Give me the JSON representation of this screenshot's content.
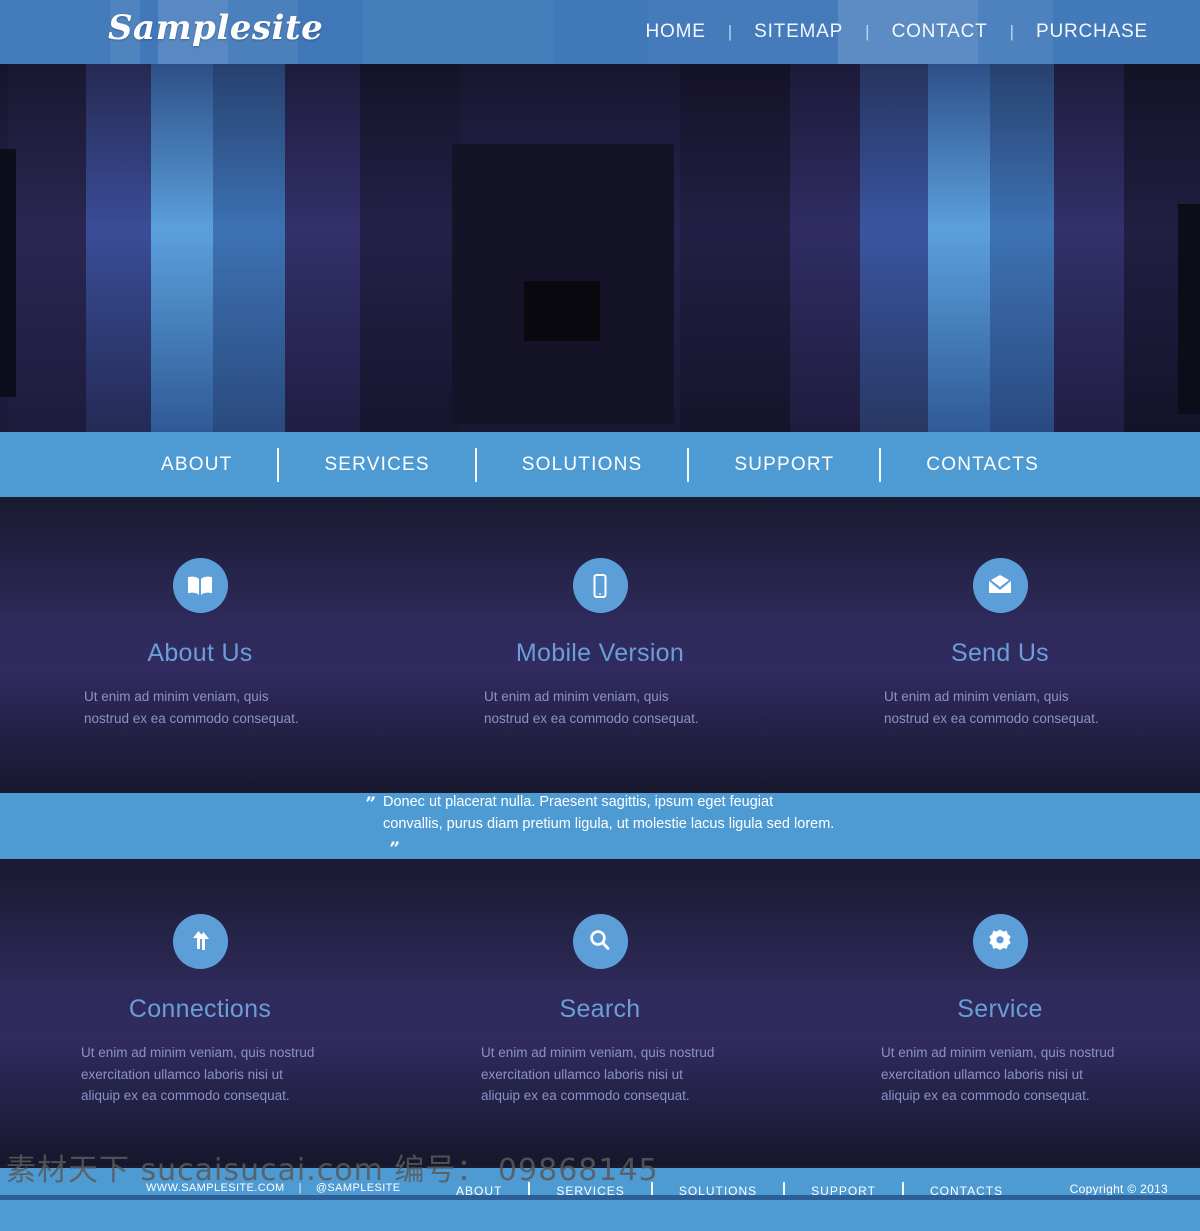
{
  "header": {
    "logo": "Samplesite",
    "nav": [
      {
        "label": "HOME"
      },
      {
        "label": "SITEMAP"
      },
      {
        "label": "CONTACT"
      },
      {
        "label": "PURCHASE"
      }
    ],
    "separator": "|"
  },
  "subnav": {
    "items": [
      {
        "label": "ABOUT"
      },
      {
        "label": "SERVICES"
      },
      {
        "label": "SOLUTIONS"
      },
      {
        "label": "SUPPORT"
      },
      {
        "label": "CONTACTS"
      }
    ]
  },
  "features_row1": [
    {
      "icon": "book-icon",
      "title": "About Us",
      "text": "Ut enim ad minim veniam, quis nostrud ex ea commodo consequat."
    },
    {
      "icon": "mobile-phone-icon",
      "title": "Mobile Version",
      "text": "Ut enim ad minim veniam, quis nostrud ex ea commodo consequat."
    },
    {
      "icon": "envelope-icon",
      "title": "Send Us",
      "text": "Ut enim ad minim veniam, quis nostrud ex ea commodo consequat."
    }
  ],
  "quote": {
    "open_mark": "”",
    "text": "Donec ut placerat nulla. Praesent sagittis, ipsum eget feugiat convallis, purus diam pretium ligula, ut molestie lacus ligula sed lorem.",
    "close_mark": "”"
  },
  "features_row2": [
    {
      "icon": "transfer-arrows-icon",
      "title": "Connections",
      "text": "Ut enim ad minim veniam, quis nostrud exercitation ullamco laboris nisi ut aliquip ex ea commodo consequat."
    },
    {
      "icon": "search-icon",
      "title": "Search",
      "text": "Ut enim ad minim veniam, quis nostrud exercitation ullamco laboris nisi ut aliquip ex ea commodo consequat."
    },
    {
      "icon": "gear-icon",
      "title": "Service",
      "text": "Ut enim ad minim veniam, quis nostrud exercitation ullamco laboris nisi ut aliquip ex ea commodo consequat."
    }
  ],
  "footer": {
    "site_url": "WWW.SAMPLESITE.COM",
    "separator": "|",
    "social_handle": "@SAMPLESITE",
    "nav": [
      {
        "label": "ABOUT"
      },
      {
        "label": "SERVICES"
      },
      {
        "label": "SOLUTIONS"
      },
      {
        "label": "SUPPORT"
      },
      {
        "label": "CONTACTS"
      }
    ],
    "copyright": "Copyright © 2013"
  },
  "watermark": {
    "text": "素材天下 sucaisucai.com  编号： 09868145"
  },
  "colors": {
    "header_blue": "#3d76b8",
    "accent_blue": "#4e9bd4",
    "icon_circle": "#5c9fd8",
    "title_blue": "#6b9ddb",
    "body_text": "#8a93c4",
    "dark_navy": "#191a31",
    "purple": "#312b5f"
  }
}
